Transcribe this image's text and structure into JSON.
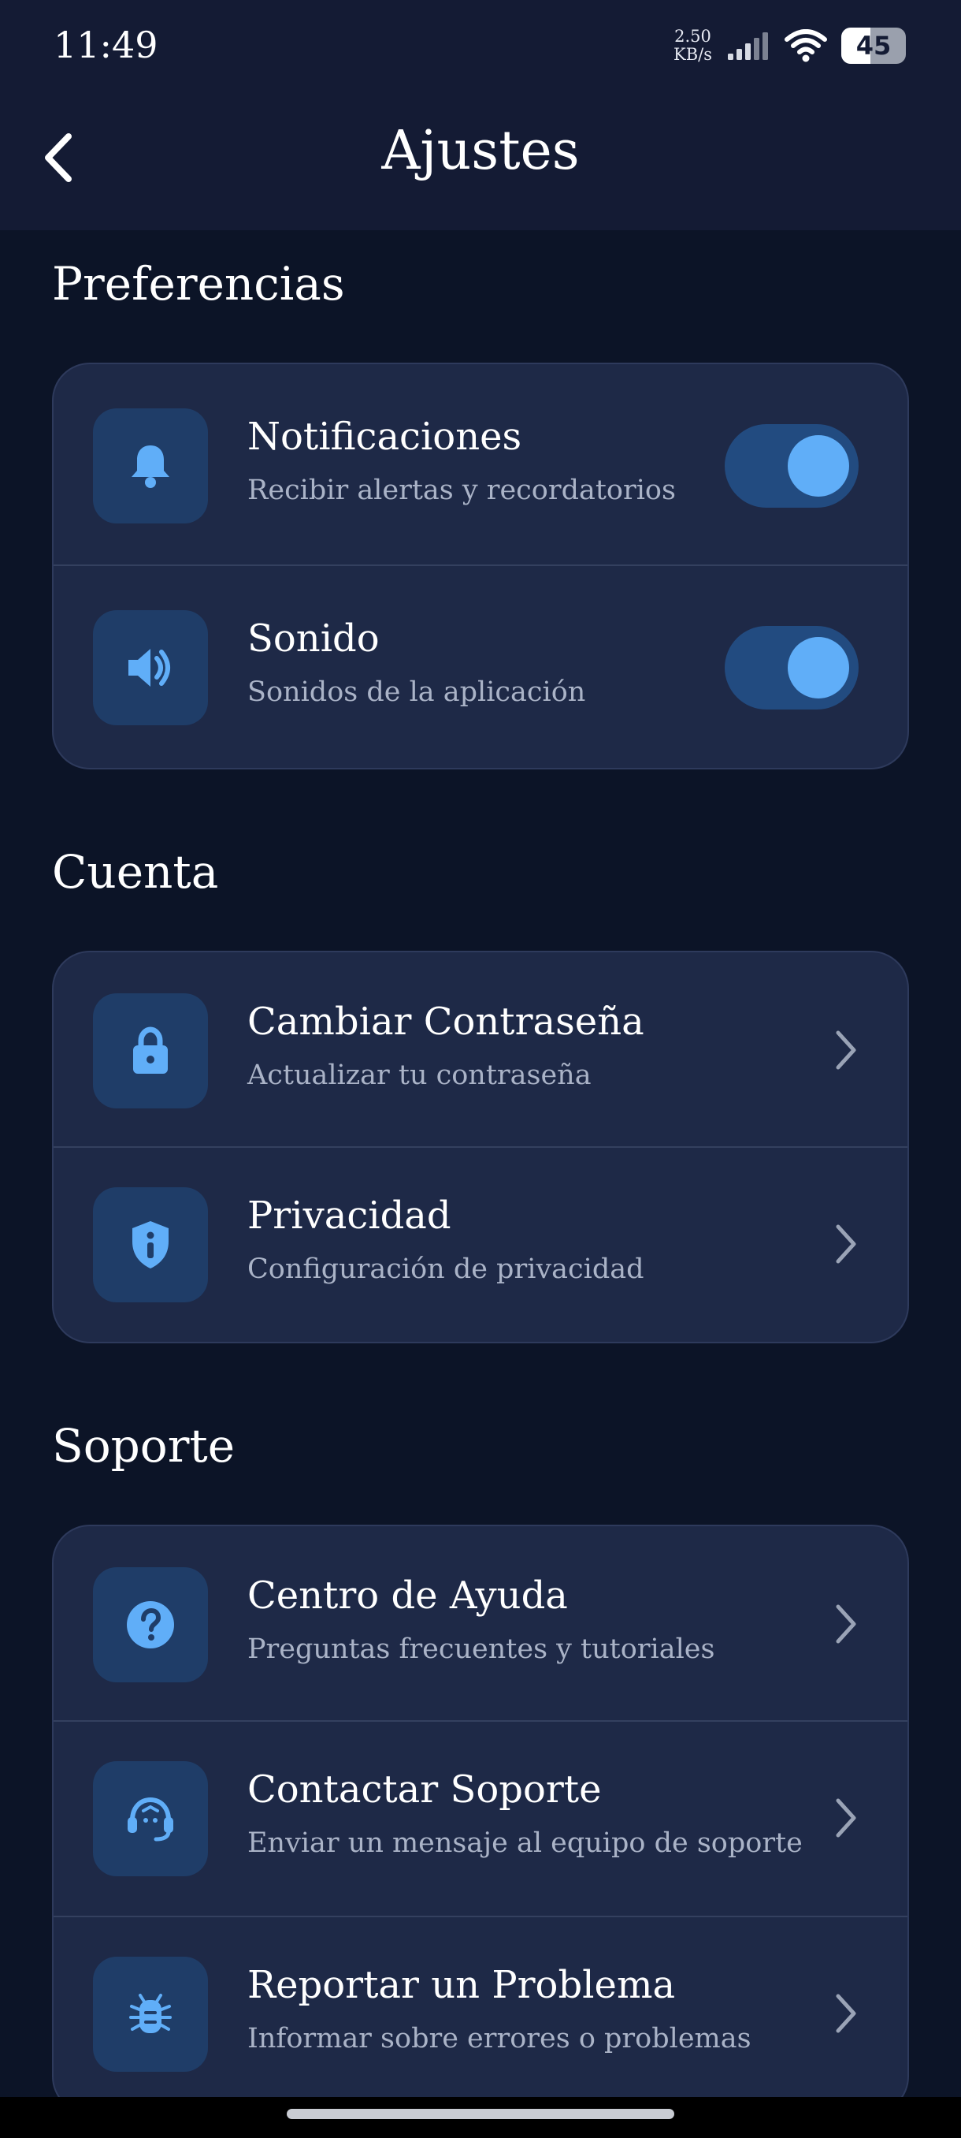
{
  "status_bar": {
    "time": "11:49",
    "net_speed_value": "2.50",
    "net_speed_unit": "KB/s",
    "battery": "45",
    "battery_level": 0.45
  },
  "header": {
    "title": "Ajustes"
  },
  "sections": [
    {
      "title": "Preferencias",
      "items": [
        {
          "title": "Notificaciones",
          "subtitle": "Recibir alertas y recordatorios",
          "icon": "bell-icon",
          "toggle_on": true
        },
        {
          "title": "Sonido",
          "subtitle": "Sonidos de la aplicación",
          "icon": "volume-icon",
          "toggle_on": true
        }
      ]
    },
    {
      "title": "Cuenta",
      "items": [
        {
          "title": "Cambiar Contraseña",
          "subtitle": "Actualizar tu contraseña",
          "icon": "lock-icon"
        },
        {
          "title": "Privacidad",
          "subtitle": "Configuración de privacidad",
          "icon": "shield-info-icon"
        }
      ]
    },
    {
      "title": "Soporte",
      "items": [
        {
          "title": "Centro de Ayuda",
          "subtitle": "Preguntas frecuentes y tutoriales",
          "icon": "help-circle-icon"
        },
        {
          "title": "Contactar Soporte",
          "subtitle": "Enviar un mensaje al equipo de soporte",
          "icon": "headset-icon"
        },
        {
          "title": "Reportar un Problema",
          "subtitle": "Informar sobre errores o problemas",
          "icon": "bug-icon"
        }
      ]
    }
  ],
  "colors": {
    "background": "#0c1427",
    "card": "#1e2947",
    "accent": "#60aef8",
    "icon_tile": "#1f3d68",
    "toggle_track": "#224b80"
  }
}
